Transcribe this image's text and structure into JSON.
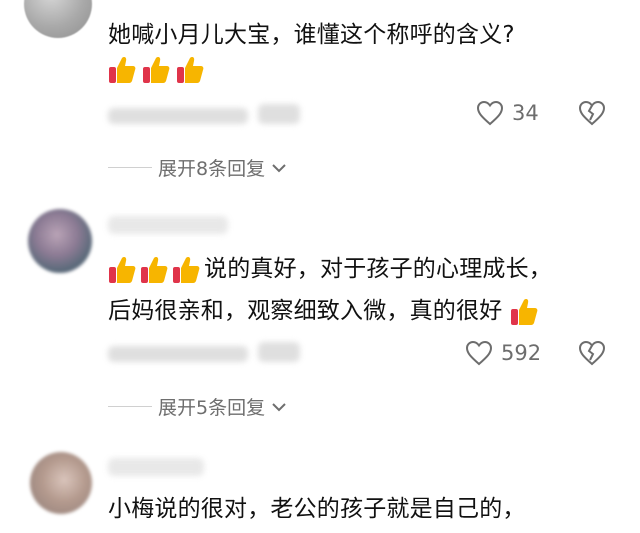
{
  "colors": {
    "text": "#111111",
    "muted": "#6e6e6e",
    "accent_thumb": "#f7b500",
    "accent_thumb_cuff": "#e0344a"
  },
  "comments": [
    {
      "text_line1": "她喊小月儿大宝，谁懂这个称呼的含义?",
      "emoji_icons": [
        "thumbs-up-icon",
        "thumbs-up-icon",
        "thumbs-up-icon"
      ],
      "likes": "34",
      "replies_label": "展开8条回复"
    },
    {
      "text_line1": "说的真好，对于孩子的心理成长，",
      "text_line2": "后妈很亲和，观察细致入微，真的很好",
      "emoji_icons": [
        "thumbs-up-icon",
        "thumbs-up-icon",
        "thumbs-up-icon"
      ],
      "likes": "592",
      "replies_label": "展开5条回复"
    },
    {
      "text_line1": "小梅说的很对，老公的孩子就是自己的，"
    }
  ]
}
